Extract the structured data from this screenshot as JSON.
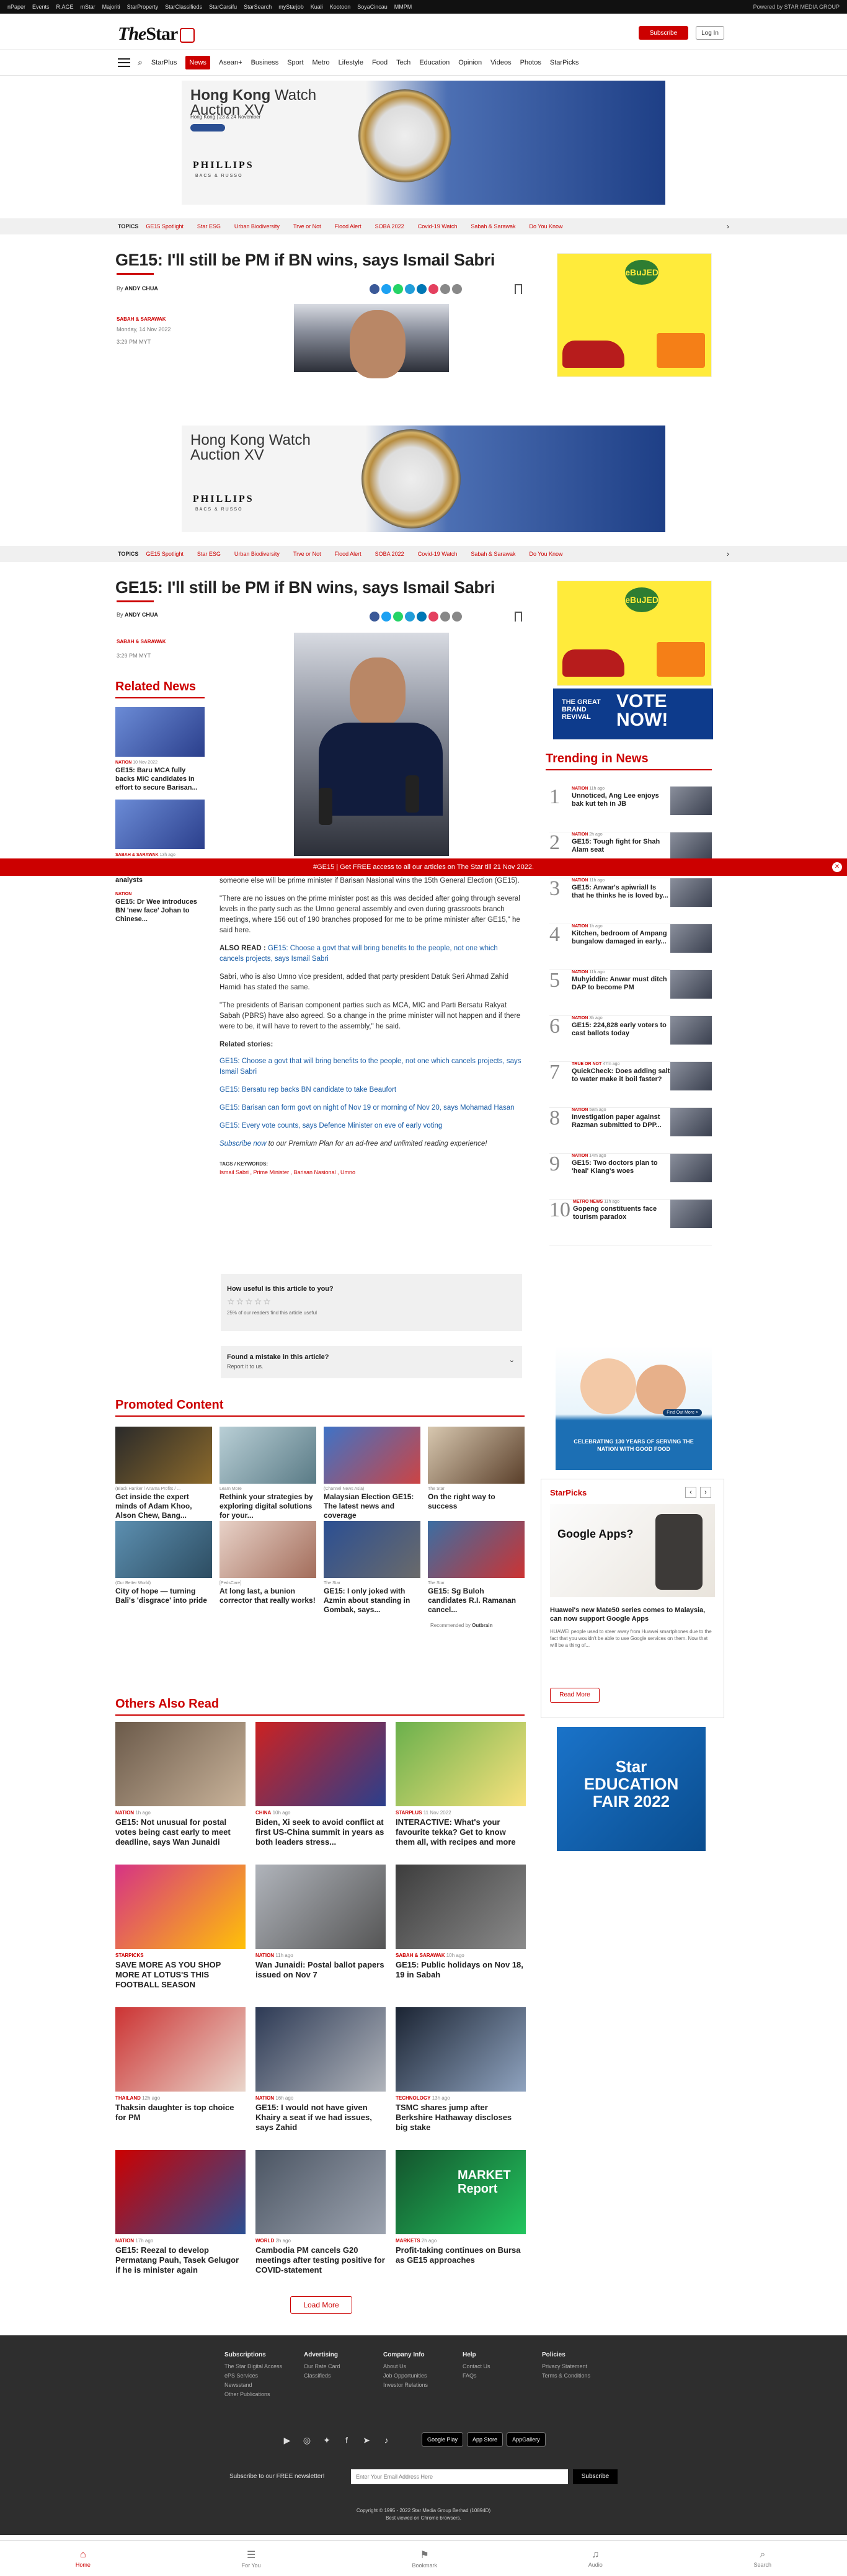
{
  "topbar": {
    "links": [
      "nPaper",
      "Events",
      "R.AGE",
      "mStar",
      "Majoriti",
      "StarProperty",
      "StarClassifieds",
      "StarCarsifu",
      "StarSearch",
      "myStarjob",
      "Kuali",
      "Kootoon",
      "SoyaCincau",
      "MMPM"
    ],
    "powered": "Powered by STAR MEDIA GROUP"
  },
  "header": {
    "logo_the": "The",
    "logo_star": "Star",
    "subscribe": "Subscribe",
    "login": "Log In"
  },
  "nav": {
    "items": [
      "StarPlus",
      "News",
      "Asean+",
      "Business",
      "Sport",
      "Metro",
      "Lifestyle",
      "Food",
      "Tech",
      "Education",
      "Opinion",
      "Videos",
      "Photos",
      "StarPicks"
    ],
    "active": "News"
  },
  "ad_phillips": {
    "title_bold": "Hong Kong",
    "title_light": " Watch",
    "subtitle": "Auction XV",
    "date": "Hong Kong | 23 & 24 November",
    "brand": "PHILLIPS",
    "partner": "BACS & RUSSO"
  },
  "topics": {
    "label": "TOPICS",
    "items": [
      "GE15 Spotlight",
      "Star ESG",
      "Urban Biodiversity",
      "Trve or Not",
      "Flood Alert",
      "SOBA 2022",
      "Covid-19 Watch",
      "Sabah & Sarawak",
      "Do You Know"
    ]
  },
  "article": {
    "headline": "GE15: I'll still be PM if BN wins, says Ismail Sabri",
    "by": "By",
    "author": "ANDY CHUA",
    "category": "SABAH & SARAWAK",
    "date": "Monday, 14 Nov 2022",
    "time": "3:29 PM MYT",
    "lead_cut": "someone else will be prime minister if Barisan Nasional wins the 15th General Election (GE15).",
    "p1": "\"There are no issues on the prime minister post as this was decided after going through several levels in the party such as the Umno general assembly and even during grassroots branch meetings, where 156 out of 190 branches proposed for me to be prime minister after GE15,\" he said here.",
    "also_read_label": "ALSO READ :",
    "also_read": "GE15: Choose a govt that will bring benefits to the people, not one which cancels projects, says Ismail Sabri",
    "p2": "Sabri, who is also Umno vice president, added that party president Datuk Seri Ahmad Zahid Hamidi has stated the same.",
    "p3": "\"The presidents of Barisan component parties such as MCA, MIC and Parti Bersatu Rakyat Sabah (PBRS) have also agreed. So a change in the prime minister will not happen and if there were to be, it will have to revert to the assembly,\" he said.",
    "related_label": "Related stories:",
    "related": [
      "GE15: Choose a govt that will bring benefits to the people, not one which cancels projects, says Ismail Sabri",
      "GE15: Bersatu rep backs BN candidate to take Beaufort",
      "GE15: Barisan can form govt on night of Nov 19 or morning of Nov 20, says Mohamad Hasan",
      "GE15: Every vote counts, says Defence Minister on eve of early voting"
    ],
    "subscribe_link": "Subscribe now",
    "subscribe_rest": " to our Premium Plan for an ad-free and unlimited reading experience!",
    "tags_label": "TAGS / KEYWORDS:",
    "tags": "Ismail Sabri , Prime Minister , Barisan Nasional , Umno"
  },
  "rating": {
    "question": "How useful is this article to you?",
    "stat": "25% of our readers find this article useful"
  },
  "mistake": {
    "title": "Found a mistake in this article?",
    "sub": "Report it to us."
  },
  "promo_bar": {
    "text": "#GE15  |  Get FREE access to all our articles on The Star till 21 Nov 2022.",
    "close": "✕"
  },
  "related_news": {
    "title": "Related News",
    "items": [
      {
        "cat": "NATION",
        "time": "10 Nov 2022",
        "title": "GE15: Baru MCA fully backs MIC candidates in effort to secure Barisan..."
      },
      {
        "cat": "SABAH & SARAWAK",
        "time": "13h ago",
        "title": "GPS will play key role in forming next govt, say analysts"
      },
      {
        "cat": "NATION",
        "time": "",
        "title": "GE15: Dr Wee introduces BN 'new face' Johan to Chinese..."
      }
    ]
  },
  "trending": {
    "title": "Trending in News",
    "items": [
      {
        "cat": "NATION",
        "time": "11h ago",
        "title": "Unnoticed, Ang Lee enjoys bak kut teh in JB"
      },
      {
        "cat": "NATION",
        "time": "2h ago",
        "title": "GE15: Tough fight for Shah Alam seat"
      },
      {
        "cat": "NATION",
        "time": "11h ago",
        "title": "GE15: Anwar's apiwriall Is that he thinks he is loved by..."
      },
      {
        "cat": "NATION",
        "time": "1h ago",
        "title": "Kitchen, bedroom of Ampang bungalow damaged in early..."
      },
      {
        "cat": "NATION",
        "time": "11h ago",
        "title": "Muhyiddin: Anwar must ditch DAP to become PM"
      },
      {
        "cat": "NATION",
        "time": "3h ago",
        "title": "GE15: 224,828 early voters to cast ballots today"
      },
      {
        "cat": "TRUE OR NOT",
        "time": "47m ago",
        "title": "QuickCheck: Does adding salt to water make it boil faster?"
      },
      {
        "cat": "NATION",
        "time": "59m ago",
        "title": "Investigation paper against Razman submitted to DPP..."
      },
      {
        "cat": "NATION",
        "time": "14m ago",
        "title": "GE15: Two doctors plan to 'heal' Klang's woes"
      },
      {
        "cat": "METRO NEWS",
        "time": "11h ago",
        "title": "Gopeng constituents face tourism paradox"
      }
    ]
  },
  "right_ads": {
    "car_badge": "eBuJED",
    "vote_great": "THE GREAT BRAND REVIVAL",
    "vote_text": "VOTE NOW!",
    "cny_caption": "CELEBRATING 130 YEARS OF SERVING THE NATION WITH GOOD FOOD",
    "cny_btn": "Find Out More >",
    "edu_title": "Star EDUCATION FAIR 2022"
  },
  "starpicks": {
    "title": "StarPicks",
    "img_title": "Google Apps?",
    "headline": "Huawei's new Mate50 series comes to Malaysia, can now support Google Apps",
    "desc": "HUAWEI people used to steer away from Huawei smartphones due to the fact that you wouldn't be able to use Google services on them. Now that will be a thing of...",
    "btn": "Read More"
  },
  "promoted": {
    "title": "Promoted Content",
    "items": [
      {
        "src": "(Black Hanker / Anama Profits / ...",
        "title": "Get inside the expert minds of Adam Khoo, Alson Chew, Bang..."
      },
      {
        "src": "Learn More",
        "title": "Rethink your strategies by exploring digital solutions for your..."
      },
      {
        "src": "(Channel News Asia)",
        "title": "Malaysian Election GE15: The latest news and coverage"
      },
      {
        "src": "The Star",
        "title": "On the right way to success"
      },
      {
        "src": "(Our Better World)",
        "title": "City of hope — turning Bali's 'disgrace' into pride"
      },
      {
        "src": "[PedsCare]",
        "title": "At long last, a bunion corrector that really works!"
      },
      {
        "src": "The Star",
        "title": "GE15: I only joked with Azmin about standing in Gombak, says..."
      },
      {
        "src": "The Star",
        "title": "GE15: Sg Buloh candidates R.I. Ramanan cancel..."
      }
    ],
    "recommended": "Recommended by",
    "outbrain": "Outbrain"
  },
  "others": {
    "title": "Others Also Read",
    "items": [
      {
        "cat": "NATION",
        "time": "1h ago",
        "title": "GE15: Not unusual for postal votes being cast early to meet deadline, says Wan Junaidi"
      },
      {
        "cat": "CHINA",
        "time": "10h ago",
        "title": "Biden, Xi seek to avoid conflict at first US-China summit in years as both leaders stress..."
      },
      {
        "cat": "STARPLUS",
        "time": "11 Nov 2022",
        "title": "INTERACTIVE: What's your favourite tekka? Get to know them all, with recipes and more"
      },
      {
        "cat": "STARPICKS",
        "time": "",
        "title": "SAVE MORE AS YOU SHOP MORE AT LOTUS'S THIS FOOTBALL SEASON"
      },
      {
        "cat": "NATION",
        "time": "11h ago",
        "title": "Wan Junaidi: Postal ballot papers issued on Nov 7"
      },
      {
        "cat": "SABAH & SARAWAK",
        "time": "10h ago",
        "title": "GE15: Public holidays on Nov 18, 19 in Sabah"
      },
      {
        "cat": "THAILAND",
        "time": "12h ago",
        "title": "Thaksin daughter is top choice for PM"
      },
      {
        "cat": "NATION",
        "time": "16h ago",
        "title": "GE15: I would not have given Khairy a seat if we had issues, says Zahid"
      },
      {
        "cat": "TECHNOLOGY",
        "time": "13h ago",
        "title": "TSMC shares jump after Berkshire Hathaway discloses big stake"
      },
      {
        "cat": "NATION",
        "time": "17h ago",
        "title": "GE15: Reezal to develop Permatang Pauh, Tasek Gelugor if he is minister again"
      },
      {
        "cat": "WORLD",
        "time": "2h ago",
        "title": "Cambodia PM cancels G20 meetings after testing positive for COVID-statement"
      },
      {
        "cat": "MARKETS",
        "time": "2h ago",
        "title": "Profit-taking continues on Bursa as GE15 approaches"
      }
    ],
    "load_more": "Load More",
    "market_img": "MARKET Report"
  },
  "footer": {
    "cols": [
      {
        "h": "Subscriptions",
        "items": [
          "The Star Digital Access",
          "ePS Services",
          "Newsstand",
          "Other Publications"
        ]
      },
      {
        "h": "Advertising",
        "items": [
          "Our Rate Card",
          "Classifieds"
        ]
      },
      {
        "h": "Company Info",
        "items": [
          "About Us",
          "Job Opportunities",
          "Investor Relations"
        ]
      },
      {
        "h": "Help",
        "items": [
          "Contact Us",
          "FAQs"
        ]
      },
      {
        "h": "Policies",
        "items": [
          "Privacy Statement",
          "Terms & Conditions"
        ]
      }
    ],
    "stores": [
      "Google Play",
      "App Store",
      "AppGallery"
    ],
    "newsletter_label": "Subscribe to our FREE newsletter!",
    "newsletter_placeholder": "Enter Your Email Address Here",
    "newsletter_btn": "Subscribe",
    "copyright": "Copyright © 1995 - 2022 Star Media Group Berhad (10894D)",
    "copyright2": "Best viewed on Chrome browsers."
  },
  "bottom_nav": [
    "Home",
    "For You",
    "Bookmark",
    "Audio",
    "Search"
  ]
}
